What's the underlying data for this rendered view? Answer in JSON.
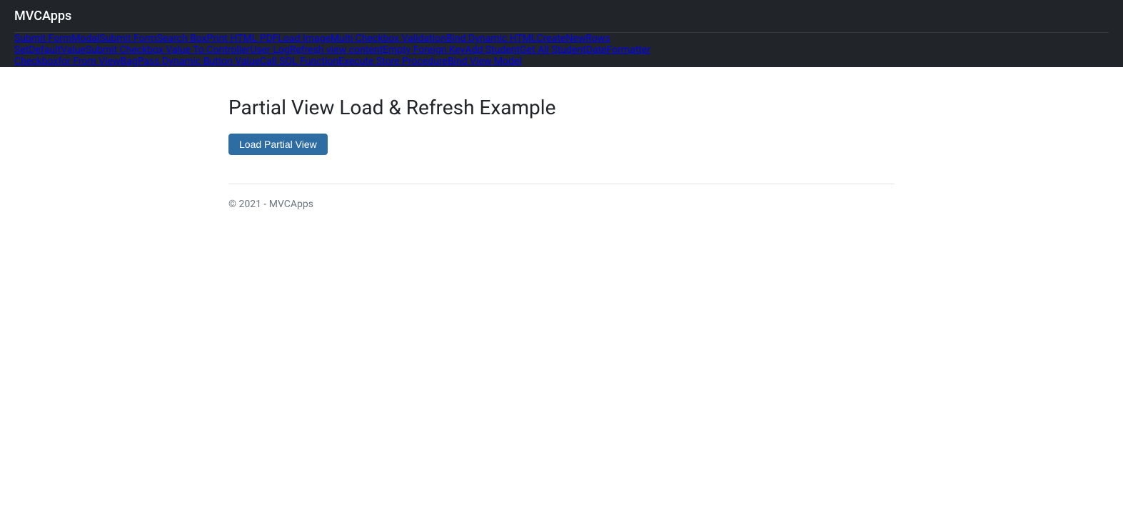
{
  "brand": "MVCApps",
  "nav": {
    "row1": [
      {
        "label": "Submit Form",
        "name": "nav-submit-form-1"
      },
      {
        "label": "Modal",
        "name": "nav-modal"
      },
      {
        "label": "Submit Form",
        "name": "nav-submit-form-2"
      },
      {
        "label": "Search Box",
        "name": "nav-search-box"
      },
      {
        "label": "Print HTML PDF",
        "name": "nav-print-html-pdf"
      },
      {
        "label": "Load Image",
        "name": "nav-load-image"
      },
      {
        "label": "Multi Checkbox Validation",
        "name": "nav-multi-checkbox"
      },
      {
        "label": "Bind Dynamic HTML",
        "name": "nav-bind-dynamic-html"
      },
      {
        "label": "CreateNewRows",
        "name": "nav-create-new-rows"
      }
    ],
    "row2": [
      {
        "label": "SetDefaultValue",
        "name": "nav-set-default-value"
      },
      {
        "label": "Submit Checkbox Value To Controller",
        "name": "nav-submit-checkbox"
      },
      {
        "label": "User Log",
        "name": "nav-user-log"
      },
      {
        "label": "Refresh view content",
        "name": "nav-refresh-view"
      },
      {
        "label": "Empty Foreign Key",
        "name": "nav-empty-foreign-key"
      },
      {
        "label": "Add Student",
        "name": "nav-add-student"
      },
      {
        "label": "Get All Student",
        "name": "nav-get-all-student"
      },
      {
        "label": "DateFormatter",
        "name": "nav-date-formatter"
      }
    ],
    "row3": [
      {
        "label": "Checkboxfor From ViewBag",
        "name": "nav-checkboxfor-viewbag"
      },
      {
        "label": "Pass Dynamic Button Value",
        "name": "nav-pass-dynamic-button"
      },
      {
        "label": "Call SQL Function",
        "name": "nav-call-sql-function"
      },
      {
        "label": "Execute Store Procedure",
        "name": "nav-execute-store-procedure"
      },
      {
        "label": "Bind View Model",
        "name": "nav-bind-view-model"
      }
    ]
  },
  "main": {
    "title": "Partial View Load & Refresh Example",
    "button_label": "Load Partial View"
  },
  "footer": {
    "text": "© 2021 - MVCApps"
  }
}
